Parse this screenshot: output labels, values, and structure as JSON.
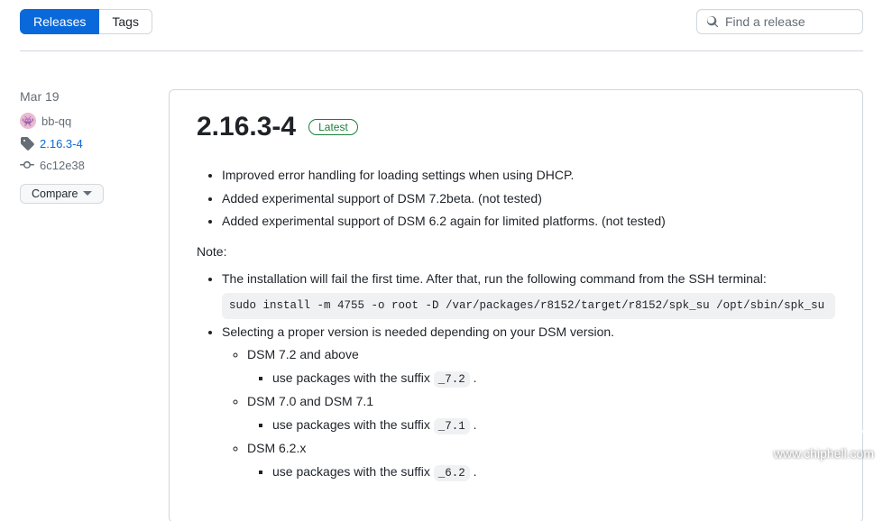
{
  "tabs": {
    "releases": "Releases",
    "tags": "Tags"
  },
  "search": {
    "placeholder": "Find a release"
  },
  "sidebar": {
    "date": "Mar 19",
    "user": "bb-qq",
    "tag": "2.16.3-4",
    "commit": "6c12e38",
    "compare": "Compare"
  },
  "release": {
    "title": "2.16.3-4",
    "badge": "Latest",
    "changes": [
      "Improved error handling for loading settings when using DHCP.",
      "Added experimental support of DSM 7.2beta. (not tested)",
      "Added experimental support of DSM 6.2 again for limited platforms. (not tested)"
    ],
    "note_label": "Note:",
    "install_note": "The installation will fail the first time. After that, run the following command from the SSH terminal:",
    "install_cmd": "sudo install -m 4755 -o root -D /var/packages/r8152/target/r8152/spk_su /opt/sbin/spk_su",
    "select_note": "Selecting a proper version is needed depending on your DSM version.",
    "versions": [
      {
        "dsm": "DSM 7.2 and above",
        "pkg_prefix": "use packages with the suffix ",
        "suffix": "_7.2",
        "tail": " ."
      },
      {
        "dsm": "DSM 7.0 and DSM 7.1",
        "pkg_prefix": "use packages with the suffix ",
        "suffix": "_7.1",
        "tail": " ."
      },
      {
        "dsm": "DSM 6.2.x",
        "pkg_prefix": "use packages with the suffix ",
        "suffix": "_6.2",
        "tail": " ."
      }
    ]
  },
  "watermark": "www.chiphell.com"
}
